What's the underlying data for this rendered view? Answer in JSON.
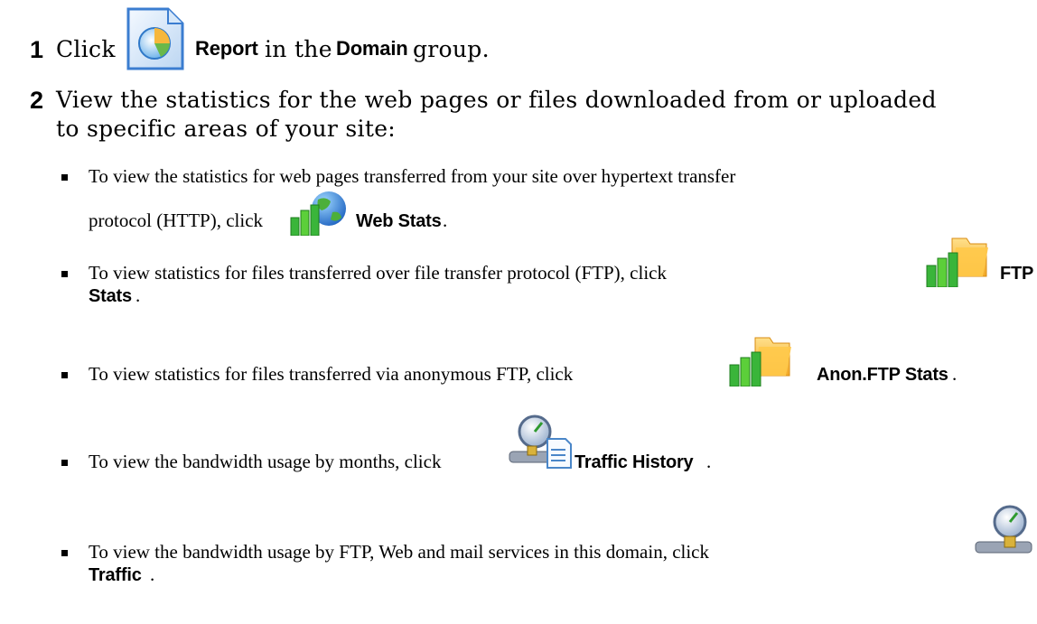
{
  "step1": {
    "number": "1",
    "click": "Click",
    "button": "Report",
    "in_the": "in the",
    "group_name": "Domain",
    "group": "group."
  },
  "step2": {
    "number": "2",
    "line1": "View the statistics for the web pages or files downloaded from or uploaded",
    "line2": "to specific areas of your site:"
  },
  "bullets": {
    "web_line1": "To view the statistics for web pages transferred from your site over hypertext transfer",
    "web_line2": "protocol (HTTP), click",
    "web_label": "Web Stats",
    "ftp_text": "To view statistics for files transferred over file transfer protocol (FTP), click",
    "ftp_label_1": "FTP",
    "ftp_label_2": "Stats",
    "anon_text": "To view statistics for files transferred via anonymous FTP, click",
    "anon_label": "Anon.FTP Stats",
    "history_text": "To view the bandwidth usage by months, click",
    "history_label": "Traffic History",
    "traffic_text": "To view the bandwidth usage by FTP, Web and mail services in this domain, click",
    "traffic_label": "Traffic",
    "period": "."
  },
  "icons": {
    "report": "report-icon",
    "web_stats": "web-stats-icon",
    "ftp_stats": "ftp-stats-icon",
    "anon_ftp_stats": "anon-ftp-stats-icon",
    "traffic_history": "traffic-history-icon",
    "traffic": "traffic-icon"
  }
}
